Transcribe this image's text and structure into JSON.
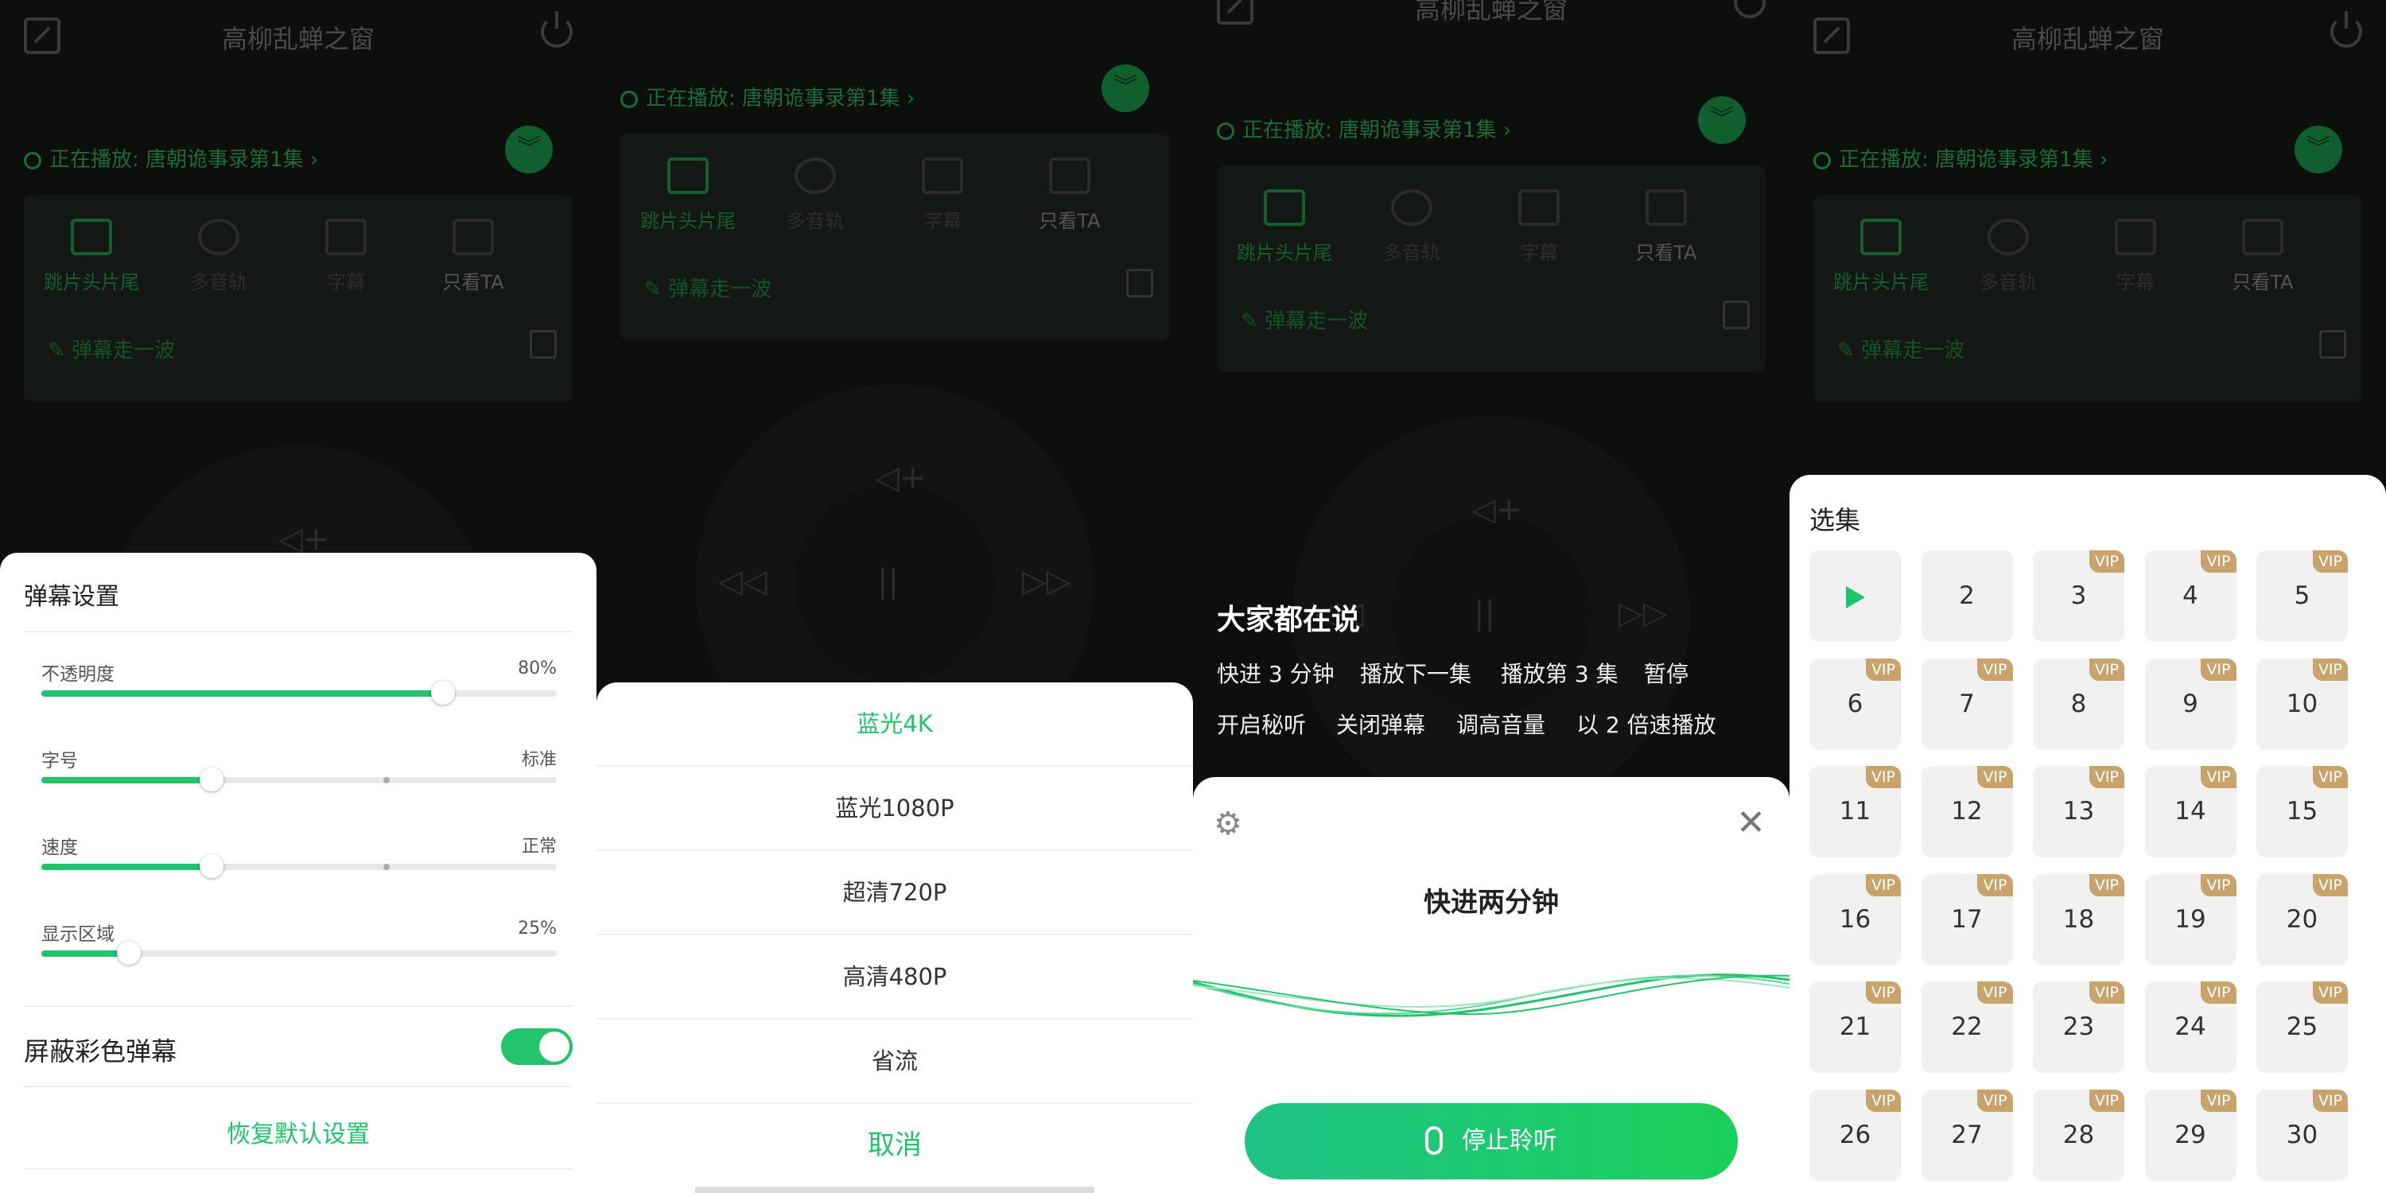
{
  "remote": {
    "title": "高柳乱蝉之窗",
    "now_playing": "正在播放: 唐朝诡事录第1集",
    "options": [
      "跳片头片尾",
      "多音轨",
      "字幕",
      "只看TA"
    ],
    "danmu_hint": "弹幕走一波"
  },
  "danmu_settings": {
    "title": "弹幕设置",
    "sliders": [
      {
        "label": "不透明度",
        "value": "80%",
        "level": 0.78
      },
      {
        "label": "字号",
        "value": "标准",
        "level": 0.33,
        "mark": 0.67
      },
      {
        "label": "速度",
        "value": "正常",
        "level": 0.33,
        "mark": 0.67
      },
      {
        "label": "显示区域",
        "value": "25%",
        "level": 0.17
      }
    ],
    "block_color_label": "屏蔽彩色弹幕",
    "block_color_on": true,
    "reset_label": "恢复默认设置"
  },
  "quality": {
    "options": [
      "蓝光4K",
      "蓝光1080P",
      "超清720P",
      "高清480P",
      "省流"
    ],
    "selected_index": 0,
    "cancel_label": "取消"
  },
  "voice": {
    "suggest_title": "大家都在说",
    "commands_row1": [
      "快进 3 分钟",
      "播放下一集",
      "播放第 3 集",
      "暂停"
    ],
    "commands_row2": [
      "开启秘听",
      "关闭弹幕",
      "调高音量",
      "以 2 倍速播放"
    ],
    "heard_text": "快进两分钟",
    "stop_label": "停止聆听"
  },
  "episodes": {
    "title": "选集",
    "vip_label": "VIP",
    "items": [
      {
        "n": "1",
        "vip": false,
        "playing": true
      },
      {
        "n": "2",
        "vip": false
      },
      {
        "n": "3",
        "vip": true
      },
      {
        "n": "4",
        "vip": true
      },
      {
        "n": "5",
        "vip": true
      },
      {
        "n": "6",
        "vip": true
      },
      {
        "n": "7",
        "vip": true
      },
      {
        "n": "8",
        "vip": true
      },
      {
        "n": "9",
        "vip": true
      },
      {
        "n": "10",
        "vip": true
      },
      {
        "n": "11",
        "vip": true
      },
      {
        "n": "12",
        "vip": true
      },
      {
        "n": "13",
        "vip": true
      },
      {
        "n": "14",
        "vip": true
      },
      {
        "n": "15",
        "vip": true
      },
      {
        "n": "16",
        "vip": true
      },
      {
        "n": "17",
        "vip": true
      },
      {
        "n": "18",
        "vip": true
      },
      {
        "n": "19",
        "vip": true
      },
      {
        "n": "20",
        "vip": true
      },
      {
        "n": "21",
        "vip": true
      },
      {
        "n": "22",
        "vip": true
      },
      {
        "n": "23",
        "vip": true
      },
      {
        "n": "24",
        "vip": true
      },
      {
        "n": "25",
        "vip": true
      },
      {
        "n": "26",
        "vip": true
      },
      {
        "n": "27",
        "vip": true
      },
      {
        "n": "28",
        "vip": true
      },
      {
        "n": "29",
        "vip": true
      },
      {
        "n": "30",
        "vip": true
      }
    ]
  },
  "colors": {
    "accent": "#21c46a",
    "vip": "#c9a36c"
  }
}
